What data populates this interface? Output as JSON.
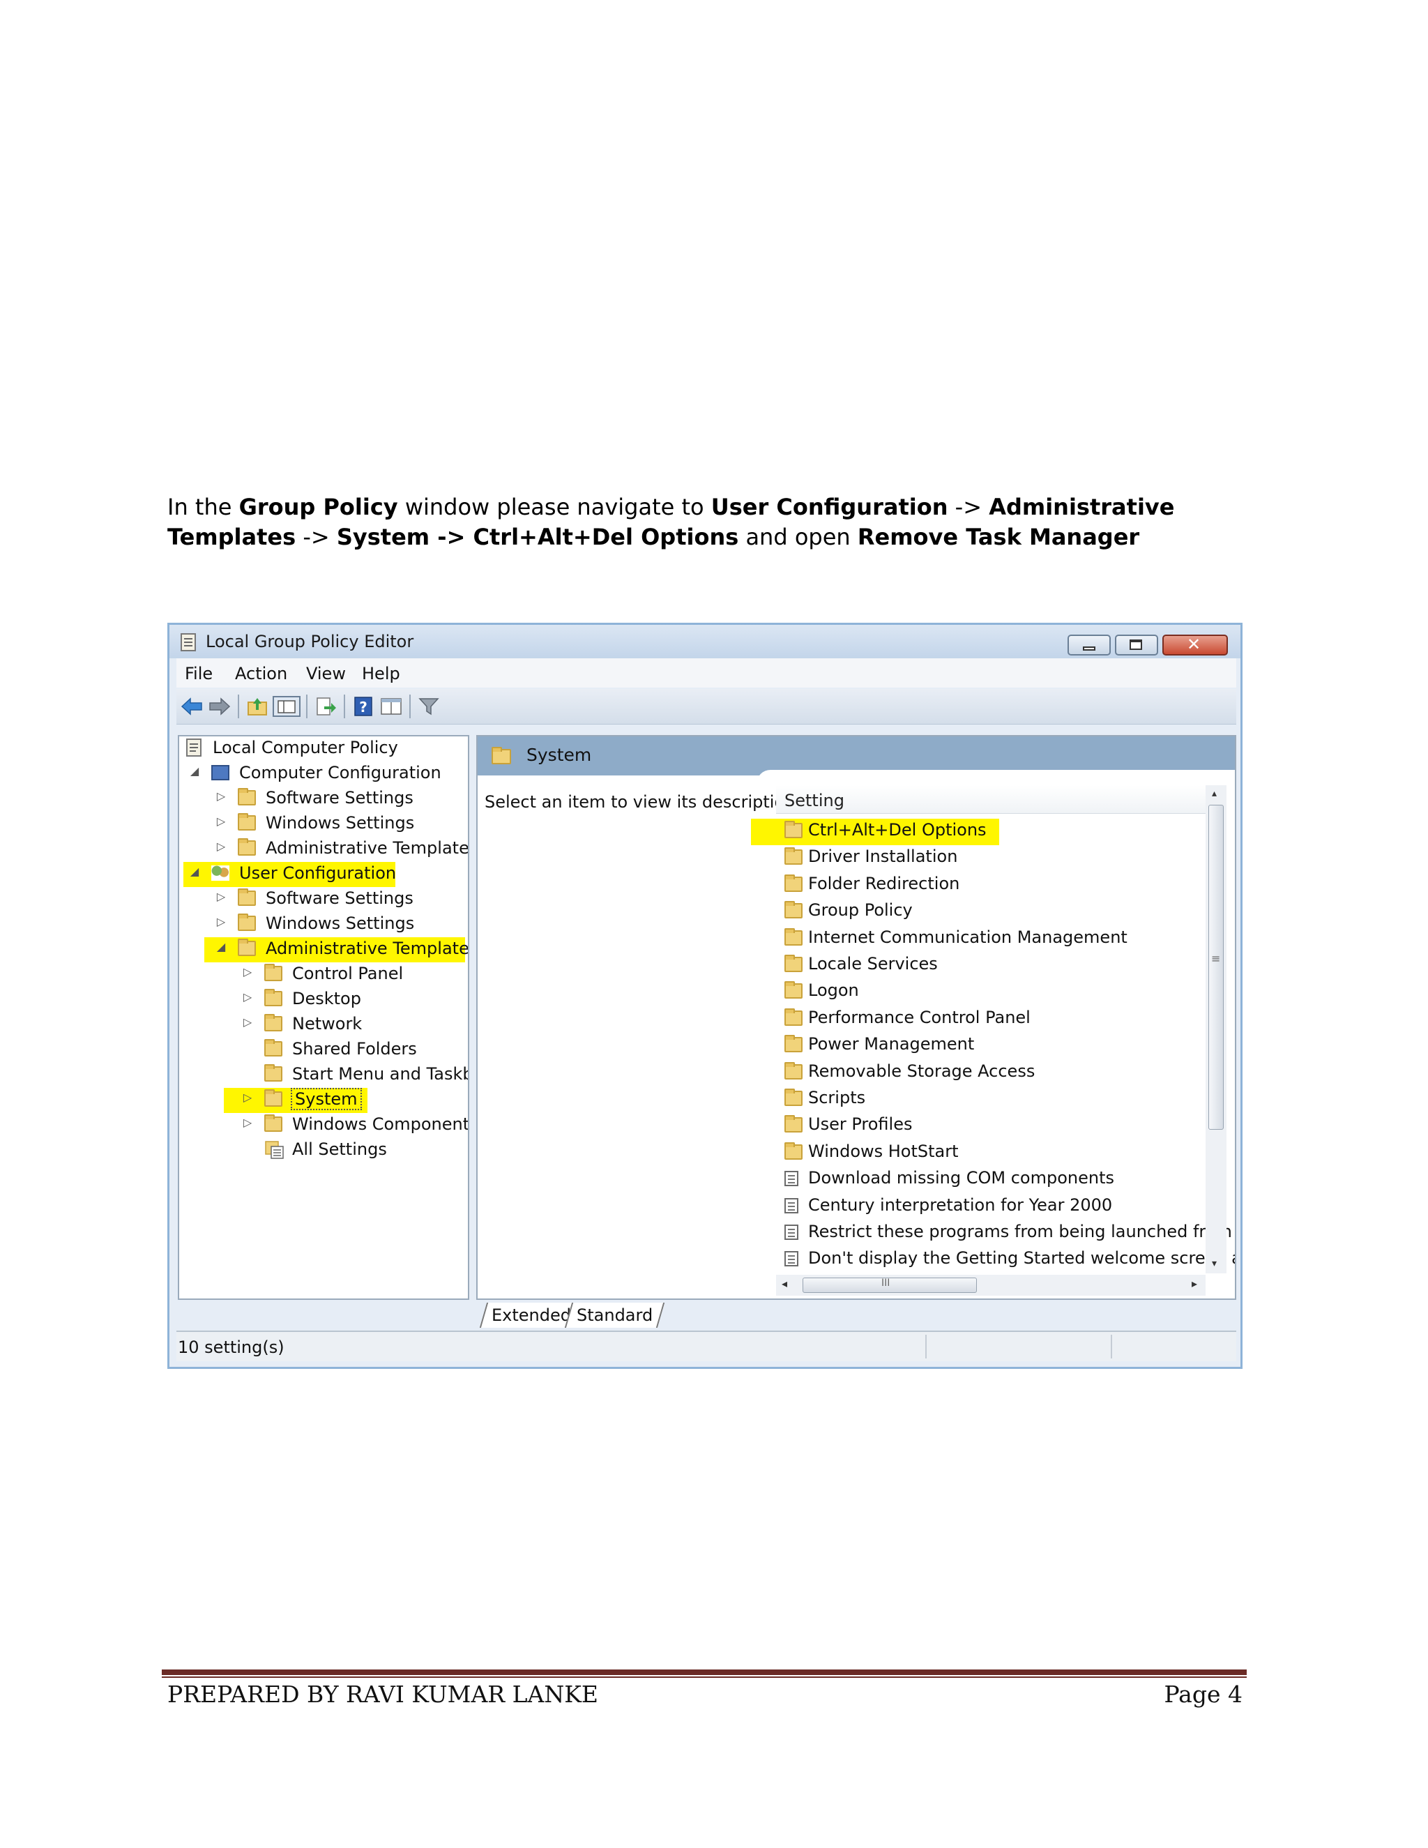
{
  "instruction": {
    "t1": "In the ",
    "b1": "Group Policy",
    "t2": " window please navigate to ",
    "b2": "User Configuration",
    "t3": " -> ",
    "b3": "Administrative Templates",
    "t4": " -> ",
    "b4": "System -> Ctrl+Alt+Del Options",
    "t5": "  and open ",
    "b5": "Remove Task Manager"
  },
  "window": {
    "title": "Local Group Policy Editor",
    "menu": [
      "File",
      "Action",
      "View",
      "Help"
    ],
    "toolbar_icons": [
      "back-icon",
      "forward-icon",
      "up-folder-icon",
      "show-hide-tree-icon",
      "export-list-icon",
      "help-icon",
      "properties-icon",
      "filter-icon"
    ],
    "tree": [
      {
        "label": "Local Computer Policy",
        "expander": "",
        "icon": "policy-doc-icon"
      },
      {
        "label": "Computer Configuration",
        "expander": "◢",
        "icon": "computer-icon"
      },
      {
        "label": "Software Settings",
        "expander": "▷",
        "icon": "folder-icon"
      },
      {
        "label": "Windows Settings",
        "expander": "▷",
        "icon": "folder-icon"
      },
      {
        "label": "Administrative Templates",
        "expander": "▷",
        "icon": "folder-icon"
      },
      {
        "label": "User Configuration",
        "expander": "◢",
        "icon": "users-icon",
        "highlighted": true
      },
      {
        "label": "Software Settings",
        "expander": "▷",
        "icon": "folder-icon"
      },
      {
        "label": "Windows Settings",
        "expander": "▷",
        "icon": "folder-icon"
      },
      {
        "label": "Administrative Templates",
        "expander": "◢",
        "icon": "folder-icon",
        "highlighted": true
      },
      {
        "label": "Control Panel",
        "expander": "▷",
        "icon": "folder-icon"
      },
      {
        "label": "Desktop",
        "expander": "▷",
        "icon": "folder-icon"
      },
      {
        "label": "Network",
        "expander": "▷",
        "icon": "folder-icon"
      },
      {
        "label": "Shared Folders",
        "expander": "",
        "icon": "folder-icon"
      },
      {
        "label": "Start Menu and Taskbar",
        "expander": "",
        "icon": "folder-icon"
      },
      {
        "label": "System",
        "expander": "▷",
        "icon": "folder-icon",
        "highlighted": true,
        "selected": true
      },
      {
        "label": "Windows Components",
        "expander": "▷",
        "icon": "folder-icon"
      },
      {
        "label": "All Settings",
        "expander": "",
        "icon": "all-settings-icon"
      }
    ],
    "right_header": "System",
    "description": "Select an item to view its description.",
    "column_header": "Setting",
    "settings": [
      {
        "label": "Ctrl+Alt+Del Options",
        "icon": "folder-icon",
        "highlighted": true
      },
      {
        "label": "Driver Installation",
        "icon": "folder-icon"
      },
      {
        "label": "Folder Redirection",
        "icon": "folder-icon"
      },
      {
        "label": "Group Policy",
        "icon": "folder-icon"
      },
      {
        "label": "Internet Communication Management",
        "icon": "folder-icon"
      },
      {
        "label": "Locale Services",
        "icon": "folder-icon"
      },
      {
        "label": "Logon",
        "icon": "folder-icon"
      },
      {
        "label": "Performance Control Panel",
        "icon": "folder-icon"
      },
      {
        "label": "Power Management",
        "icon": "folder-icon"
      },
      {
        "label": "Removable Storage Access",
        "icon": "folder-icon"
      },
      {
        "label": "Scripts",
        "icon": "folder-icon"
      },
      {
        "label": "User Profiles",
        "icon": "folder-icon"
      },
      {
        "label": "Windows HotStart",
        "icon": "folder-icon"
      },
      {
        "label": "Download missing COM components",
        "icon": "setting-icon"
      },
      {
        "label": "Century interpretation for Year 2000",
        "icon": "setting-icon"
      },
      {
        "label": "Restrict these programs from being launched from He",
        "icon": "setting-icon"
      },
      {
        "label": "Don't display the Getting Started welcome screen at lo",
        "icon": "setting-icon"
      }
    ],
    "tabs": [
      "Extended",
      "Standard"
    ],
    "status": "10 setting(s)",
    "highlight_color": "#fff600"
  },
  "footer": {
    "left": "PREPARED BY RAVI KUMAR LANKE",
    "right": "Page 4"
  }
}
